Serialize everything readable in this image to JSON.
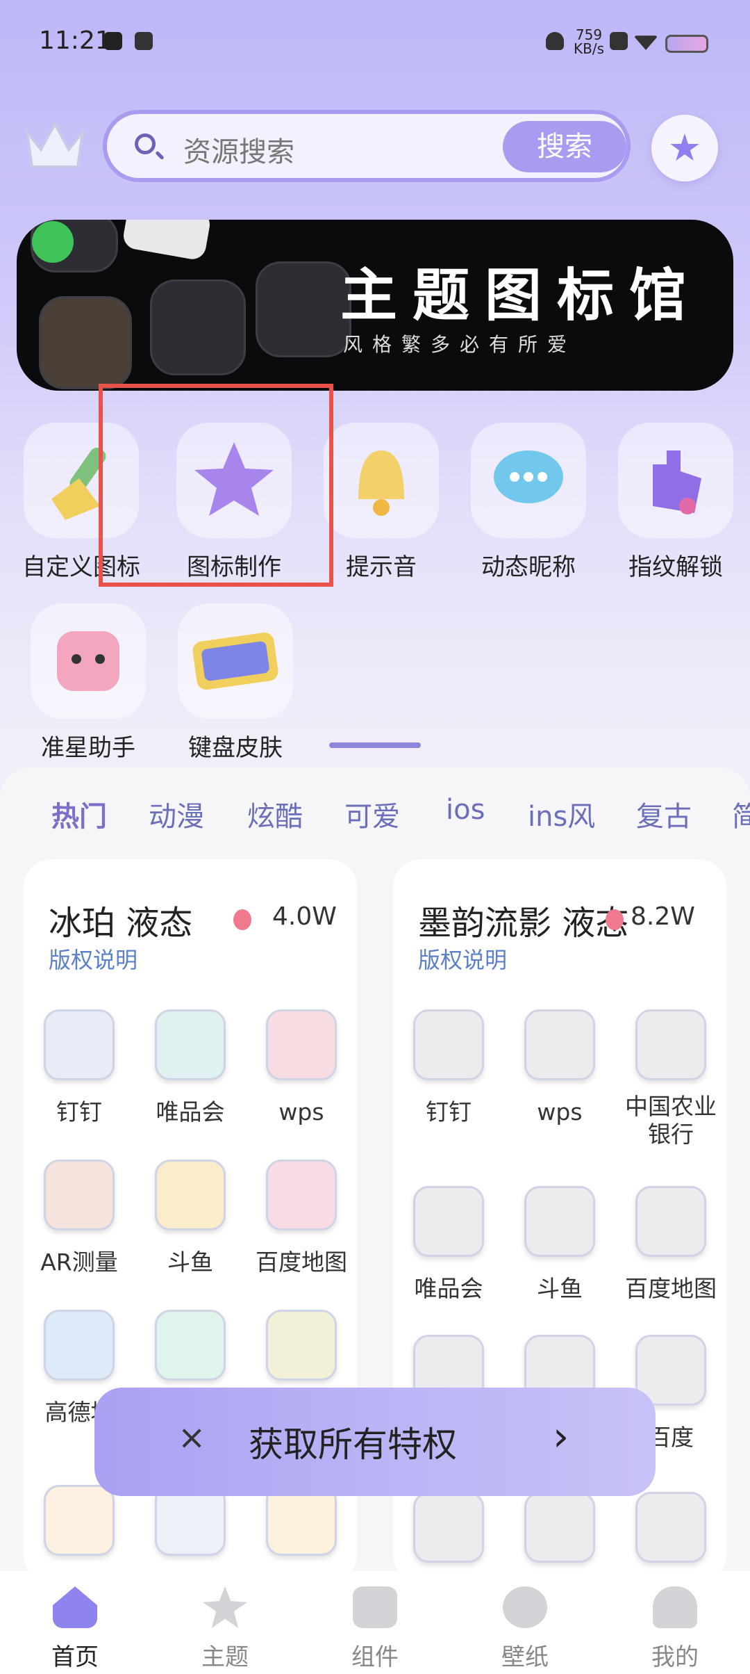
{
  "status_bar": {
    "time": "11:21",
    "net_speed": "759",
    "net_unit": "KB/s"
  },
  "search": {
    "placeholder": "资源搜索",
    "button": "搜索"
  },
  "banner": {
    "title": "主题图标馆",
    "subtitle": "风格繁多必有所爱"
  },
  "quick_items": [
    {
      "label": "自定义图标",
      "icon": "brush-icon"
    },
    {
      "label": "图标制作",
      "icon": "star-icon"
    },
    {
      "label": "提示音",
      "icon": "bell-icon"
    },
    {
      "label": "动态昵称",
      "icon": "chat-bubble-icon"
    },
    {
      "label": "指纹解锁",
      "icon": "hand-icon"
    },
    {
      "label": "准星助手",
      "icon": "robot-icon"
    },
    {
      "label": "键盘皮肤",
      "icon": "keyboard-icon"
    }
  ],
  "tabs": [
    "热门",
    "动漫",
    "炫酷",
    "可爱",
    "ios",
    "ins风",
    "复古",
    "简"
  ],
  "cards": [
    {
      "title": "冰珀 液态",
      "heat": "4.0W",
      "copyright": "版权说明",
      "apps": [
        "钉钉",
        "唯品会",
        "wps",
        "AR测量",
        "斗鱼",
        "百度地图",
        "高德地",
        "",
        ""
      ]
    },
    {
      "title": "墨韵流影 液态",
      "heat": "8.2W",
      "copyright": "版权说明",
      "apps": [
        "钉钉",
        "wps",
        "中国农业银行",
        "唯品会",
        "斗鱼",
        "百度地图",
        "",
        "",
        "百度",
        "",
        "",
        ""
      ]
    }
  ],
  "toast": {
    "close": "×",
    "text": "获取所有特权",
    "arrow": "›"
  },
  "nav": [
    "首页",
    "主题",
    "组件",
    "壁纸",
    "我的"
  ],
  "colors": {
    "accent": "#a79cf0",
    "highlight": "#e8524b",
    "link": "#5b7fc8"
  }
}
